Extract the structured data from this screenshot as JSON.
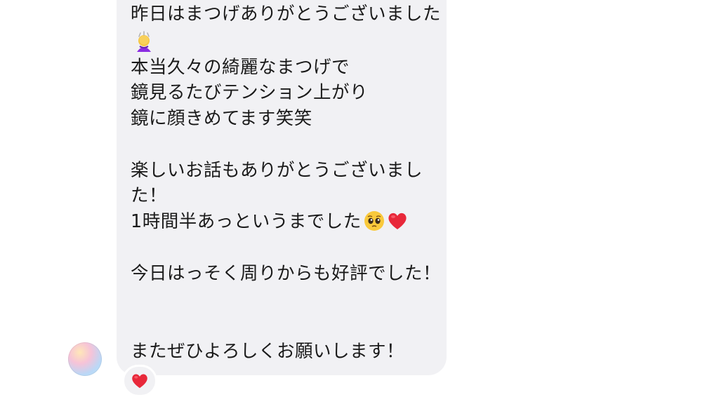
{
  "message": {
    "lines": [
      "昨日はまつげありがとうございました",
      "本当久々の綺麗なまつげで",
      "鏡見るたびテンション上がり",
      "鏡に顔きめてます笑笑",
      "楽しいお話もありがとうございまし",
      "た！",
      "1時間半あっというまでした",
      "今日はっそく周りからも好評でした！",
      "またぜひよろしくお願いします！"
    ],
    "emoji_bow": "bowing-person-emoji",
    "emoji_pleading": "pleading-face-emoji",
    "emoji_heart": "red-heart-emoji"
  },
  "reaction": {
    "emoji": "red-heart-emoji"
  },
  "colors": {
    "bubble": "#f1f1f4",
    "text": "#1a1a1a",
    "heart": "#e8283a"
  }
}
